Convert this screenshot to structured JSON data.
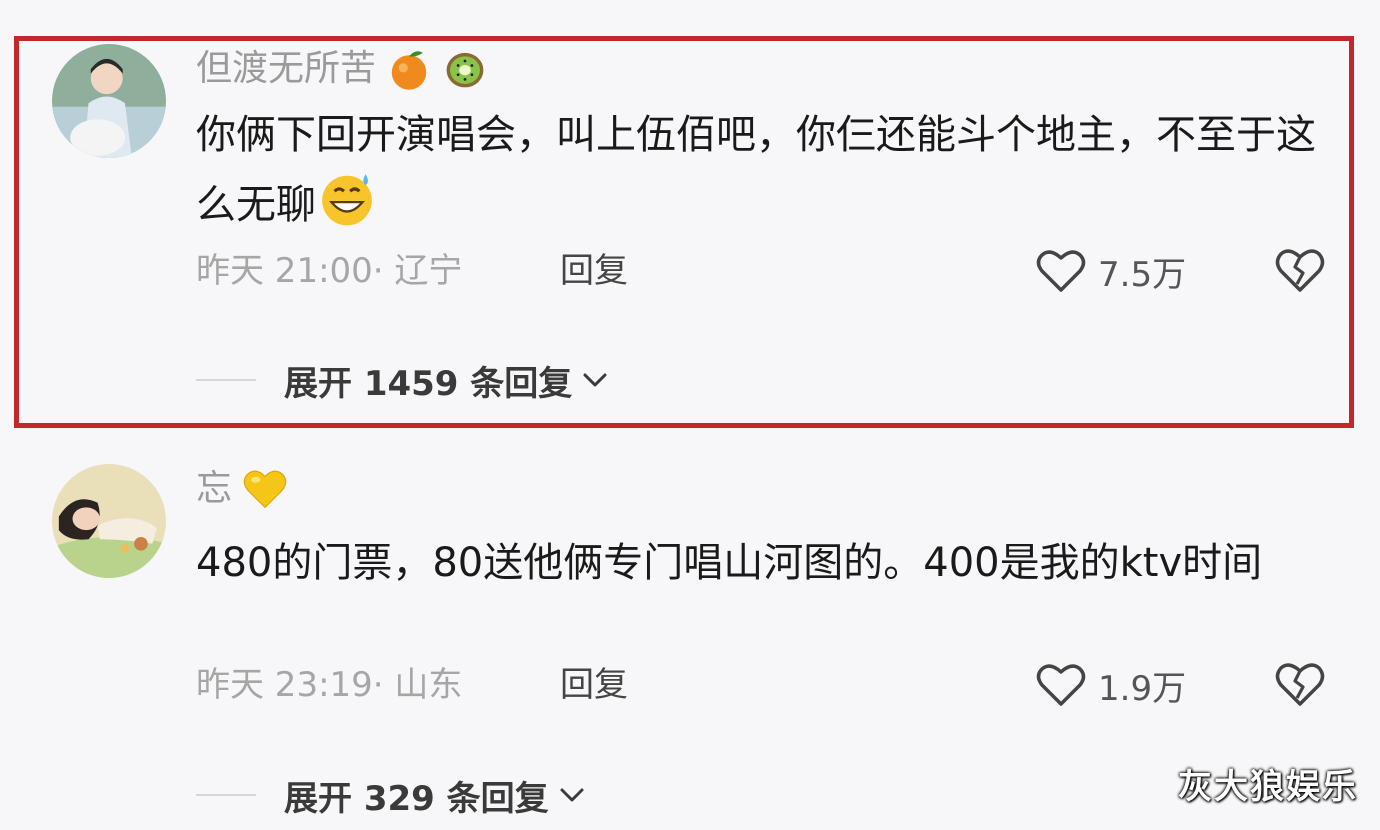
{
  "comments": [
    {
      "username": "但渡无所苦",
      "name_emojis": [
        "orange-emoji",
        "kiwi-emoji"
      ],
      "text": "你俩下回开演唱会，叫上伍佰吧，你仨还能斗个地主，不至于这么无聊",
      "text_emoji": "grin-sweat-emoji",
      "meta": "昨天 21:00· 辽宁",
      "reply_label": "回复",
      "likes": "7.5万",
      "expand_label": "展开 1459 条回复",
      "highlighted": true
    },
    {
      "username": "忘",
      "name_emojis": [
        "yellow-heart-emoji"
      ],
      "text": "480的门票，80送他俩专门唱山河图的。400是我的ktv时间",
      "meta": "昨天 23:19· 山东",
      "reply_label": "回复",
      "likes": "1.9万",
      "expand_label": "展开 329 条回复",
      "highlighted": false
    }
  ],
  "watermark": "灰大狼娱乐",
  "colors": {
    "highlight_border": "#c0282b",
    "meta_gray": "#a6a6a6",
    "background": "#f7f7f9"
  }
}
